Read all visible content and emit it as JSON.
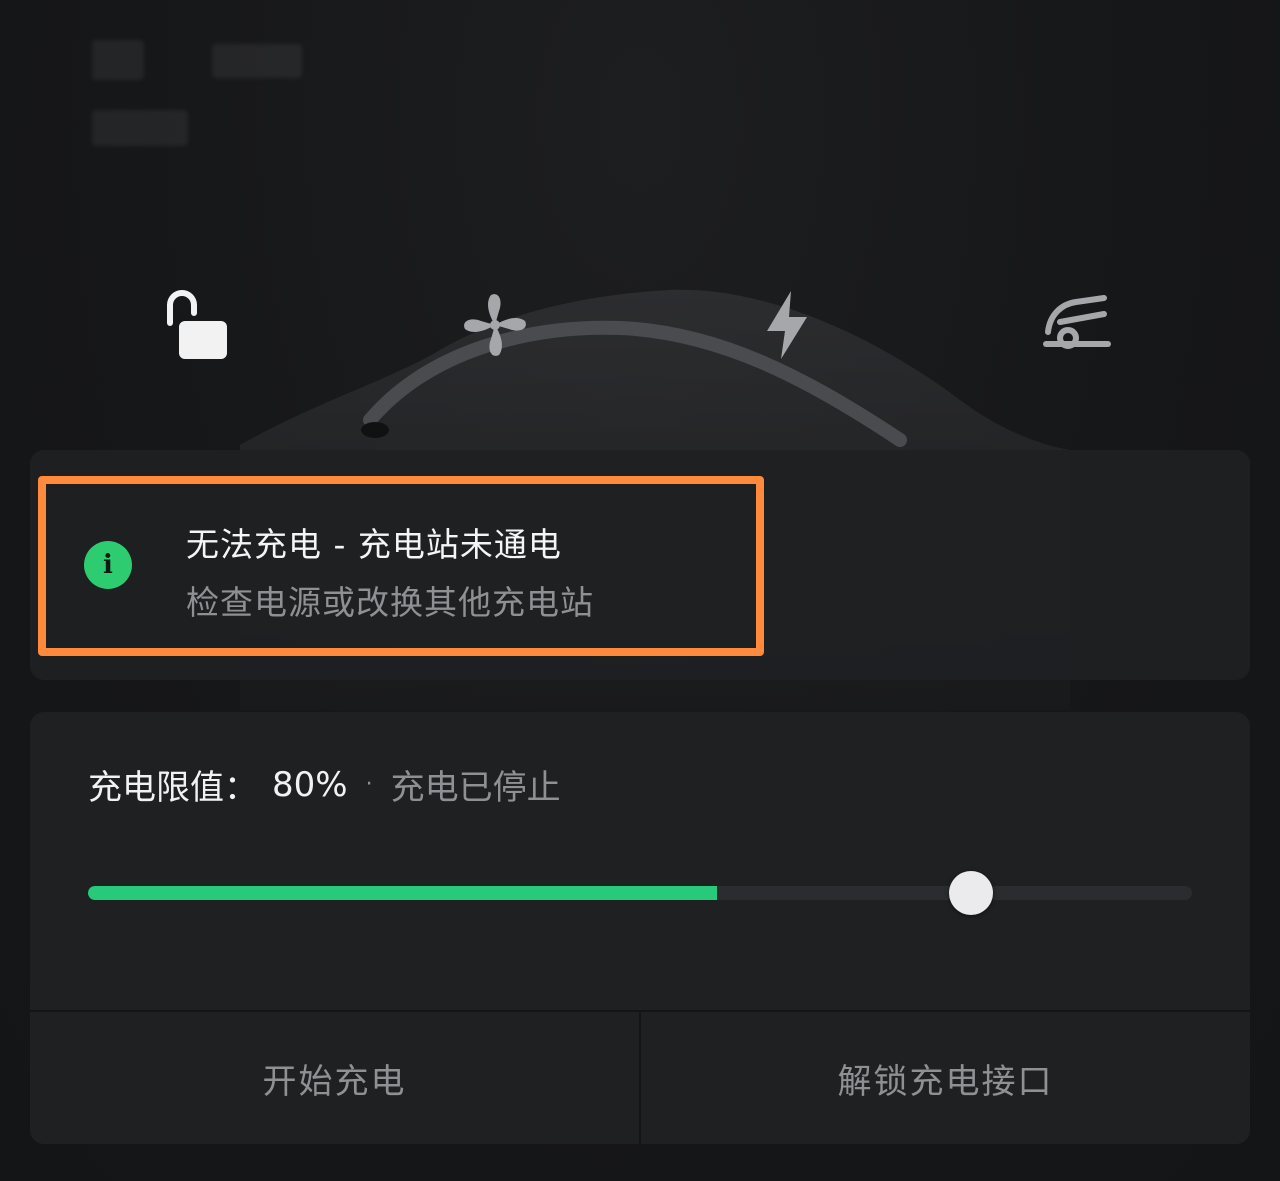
{
  "quick_actions": [
    {
      "name": "unlock",
      "icon": "unlock-icon",
      "color": "#f2f2f2"
    },
    {
      "name": "climate",
      "icon": "fan-icon",
      "color": "#a6a7aa"
    },
    {
      "name": "charging",
      "icon": "lightning-icon",
      "color": "#a6a7aa"
    },
    {
      "name": "trunk",
      "icon": "car-frunk-icon",
      "color": "#a6a7aa"
    }
  ],
  "alert": {
    "title": "无法充电 - 充电站未通电",
    "subtitle": "检查电源或改换其他充电站",
    "icon": "info-icon",
    "icon_glyph": "i",
    "badge_color": "#2ecc71",
    "highlight_color": "#ff8a3c"
  },
  "charging": {
    "limit_label": "充电限值：",
    "limit_value": "80%",
    "separator": "·",
    "status": "充电已停止",
    "current_level": 0.57,
    "limit_level": 0.8,
    "accent_color": "#27c97a"
  },
  "buttons": {
    "start_label": "开始充电",
    "unlock_port_label": "解锁充电接口"
  }
}
